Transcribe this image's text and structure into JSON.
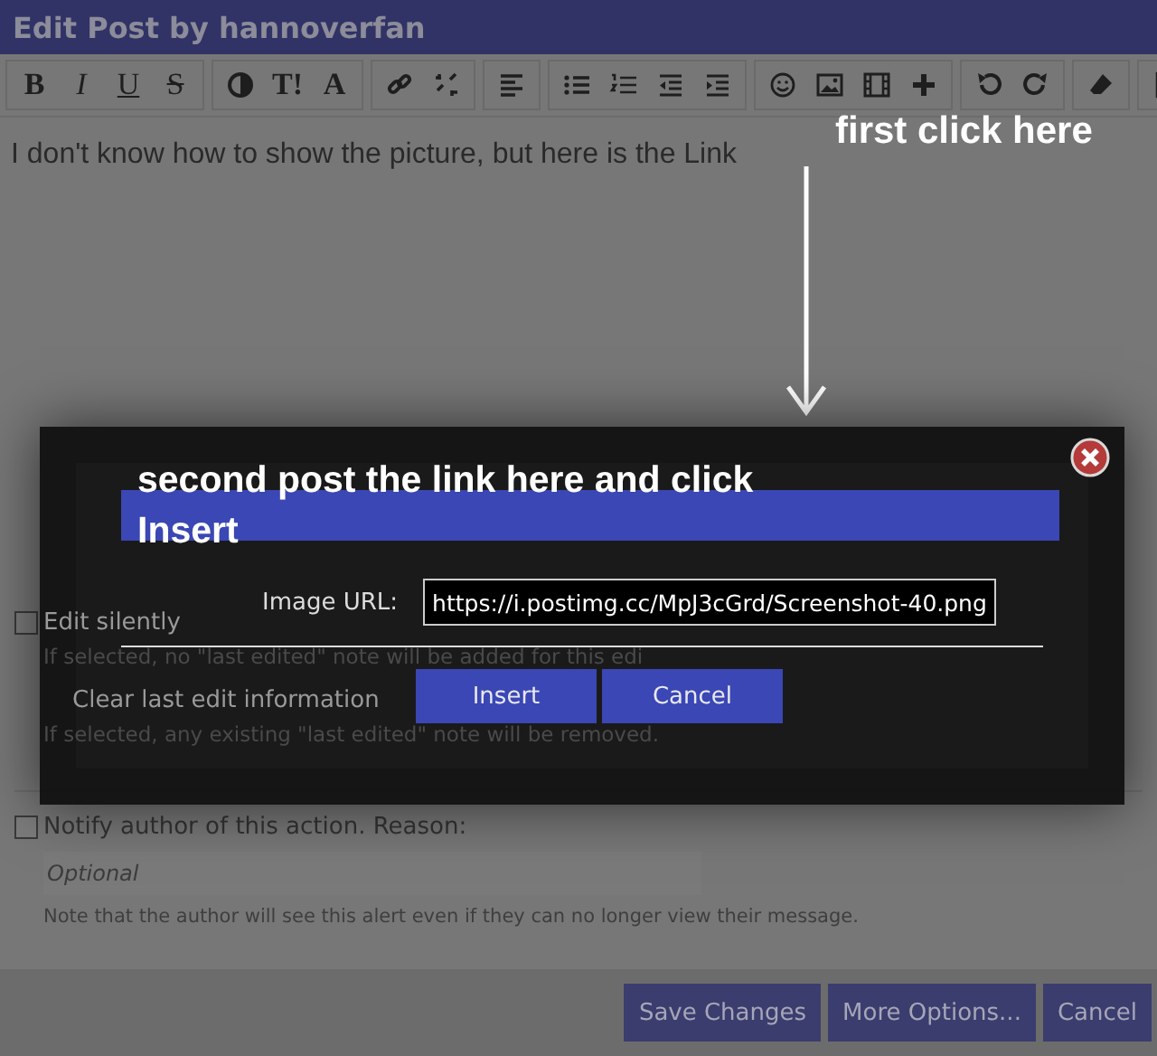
{
  "window": {
    "title": "Edit Post by hannoverfan"
  },
  "toolbar": {
    "groups": [
      [
        {
          "kind": "glyph",
          "label": "B"
        },
        {
          "kind": "glyph",
          "label": "I"
        },
        {
          "kind": "glyph",
          "label": "U"
        },
        {
          "kind": "glyph",
          "label": "S"
        }
      ],
      [
        {
          "kind": "icon"
        },
        {
          "kind": "glyph",
          "label": "T!"
        },
        {
          "kind": "glyph",
          "label": "A"
        }
      ],
      [
        {
          "kind": "icon"
        },
        {
          "kind": "icon"
        }
      ],
      [
        {
          "kind": "icon"
        }
      ],
      [
        {
          "kind": "icon"
        },
        {
          "kind": "icon"
        },
        {
          "kind": "icon"
        },
        {
          "kind": "icon"
        }
      ],
      [
        {
          "kind": "icon"
        },
        {
          "kind": "icon"
        },
        {
          "kind": "icon"
        },
        {
          "kind": "icon"
        }
      ],
      [
        {
          "kind": "icon"
        },
        {
          "kind": "icon"
        }
      ],
      [
        {
          "kind": "icon"
        }
      ],
      [
        {
          "kind": "icon"
        }
      ]
    ]
  },
  "editor": {
    "text": "I don't know how to show the picture, but here is the Link"
  },
  "annotations": {
    "first": "first click here",
    "second": "second post the link here and click Insert"
  },
  "options": [
    {
      "label": "Edit silently",
      "checked": false,
      "help": "If selected, no \"last edited\" note will be added for this edi"
    },
    {
      "label": "Clear last edit information",
      "help": "If selected, any existing \"last edited\" note will be removed."
    }
  ],
  "notify": {
    "label": "Notify author of this action. Reason:",
    "checked": false,
    "placeholder": "Optional",
    "note": "Note that the author will see this alert even if they can no longer view their message."
  },
  "dialog": {
    "field_label": "Image URL:",
    "value": "https://i.postimg.cc/MpJ3cGrd/Screenshot-40.png",
    "buttons": [
      "Insert",
      "Cancel"
    ]
  },
  "footer": {
    "buttons": [
      "Save Changes",
      "More Options...",
      "Cancel"
    ]
  }
}
